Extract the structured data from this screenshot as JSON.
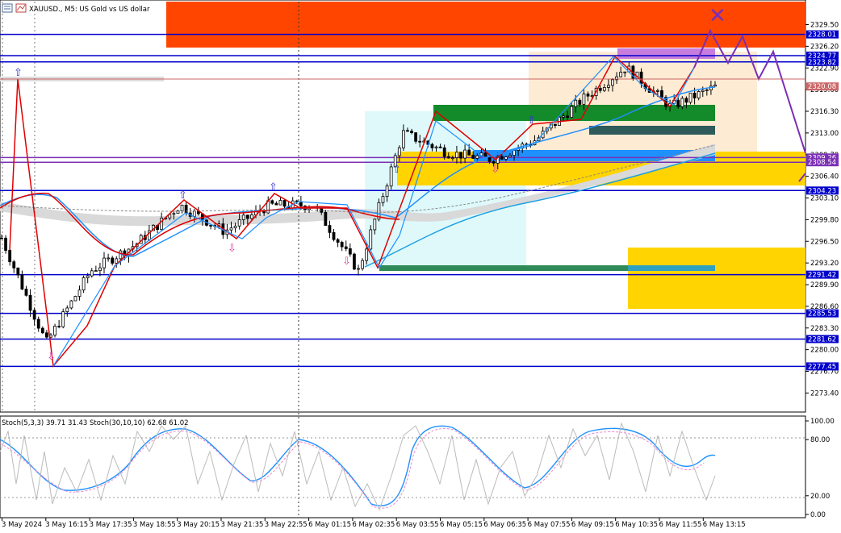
{
  "header": {
    "symbol_title": "XAUUSD., M5: US Gold vs US dollar",
    "indicator_title": "Stoch(5,3,3) 39.71 31.43 Stoch(30,10,10) 62.68 61.02"
  },
  "colors": {
    "hline": "#0000cc",
    "red_zone": "#ff4500",
    "purple_line": "#7b2fb5",
    "bull_candle": "#000000",
    "ema_red": "#e00000",
    "ma_blue": "#1e90ff",
    "green_box": "#138b2a",
    "teal_box": "#2f5b5b",
    "yellow_box": "#ffd400",
    "peach_box": "#fdebd3",
    "cyan_box": "#dff9fb",
    "current_price": "#cc6666"
  },
  "price_axis": {
    "min": 2270.5,
    "max": 2333.0,
    "ticks": [
      "2329.50",
      "2326.20",
      "2322.90",
      "2319.60",
      "2316.30",
      "2313.00",
      "2309.70",
      "2306.40",
      "2303.10",
      "2299.80",
      "2296.50",
      "2293.20",
      "2289.90",
      "2286.60",
      "2283.30",
      "2280.00",
      "2276.70",
      "2273.40"
    ]
  },
  "price_tags": [
    {
      "label": "2328.01",
      "value": 2328.01,
      "color": "#0000cc"
    },
    {
      "label": "2324.77",
      "value": 2324.77,
      "color": "#0000cc"
    },
    {
      "label": "2323.82",
      "value": 2323.82,
      "color": "#0000cc"
    },
    {
      "label": "2320.08",
      "value": 2320.08,
      "color": "#cc6666"
    },
    {
      "label": "2309.26",
      "value": 2309.26,
      "color": "#7b2fb5"
    },
    {
      "label": "2308.54",
      "value": 2308.54,
      "color": "#7b2fb5"
    },
    {
      "label": "2304.23",
      "value": 2304.23,
      "color": "#0000cc"
    },
    {
      "label": "2291.42",
      "value": 2291.42,
      "color": "#0000cc"
    },
    {
      "label": "2285.53",
      "value": 2285.53,
      "color": "#0000cc"
    },
    {
      "label": "2281.62",
      "value": 2281.62,
      "color": "#0000cc"
    },
    {
      "label": "2277.45",
      "value": 2277.45,
      "color": "#0000cc"
    }
  ],
  "time_axis": {
    "labels": [
      "3 May 2024",
      "3 May 16:15",
      "3 May 17:35",
      "3 May 18:55",
      "3 May 20:15",
      "3 May 21:35",
      "3 May 22:55",
      "6 May 01:15",
      "6 May 02:35",
      "6 May 03:55",
      "6 May 05:15",
      "6 May 06:35",
      "6 May 07:55",
      "6 May 09:15",
      "6 May 10:35",
      "6 May 11:55",
      "6 May 13:15"
    ]
  },
  "stoch_axis": {
    "ticks": [
      "100.00",
      "80.00",
      "20.00",
      "0.00"
    ]
  },
  "chart_data": {
    "type": "line",
    "title": "XAUUSD., M5: US Gold vs US dollar",
    "xlabel": "",
    "ylabel": "",
    "x": [
      "3 May 2024",
      "3 May 16:15",
      "3 May 17:35",
      "3 May 18:55",
      "3 May 20:15",
      "3 May 21:35",
      "3 May 22:55",
      "6 May 01:15",
      "6 May 02:35",
      "6 May 03:55",
      "6 May 05:15",
      "6 May 06:35",
      "6 May 07:55",
      "6 May 09:15",
      "6 May 10:35",
      "6 May 11:55",
      "6 May 13:15"
    ],
    "series": [
      {
        "values": [
          2297,
          2281,
          2292,
          2296,
          2302,
          2298,
          2302,
          2302,
          2292,
          2313,
          2310,
          2309,
          2312,
          2318,
          2323,
          2317,
          2320
        ]
      }
    ],
    "ylim": [
      2270.5,
      2333.0
    ],
    "grid": false,
    "legend": "none"
  }
}
